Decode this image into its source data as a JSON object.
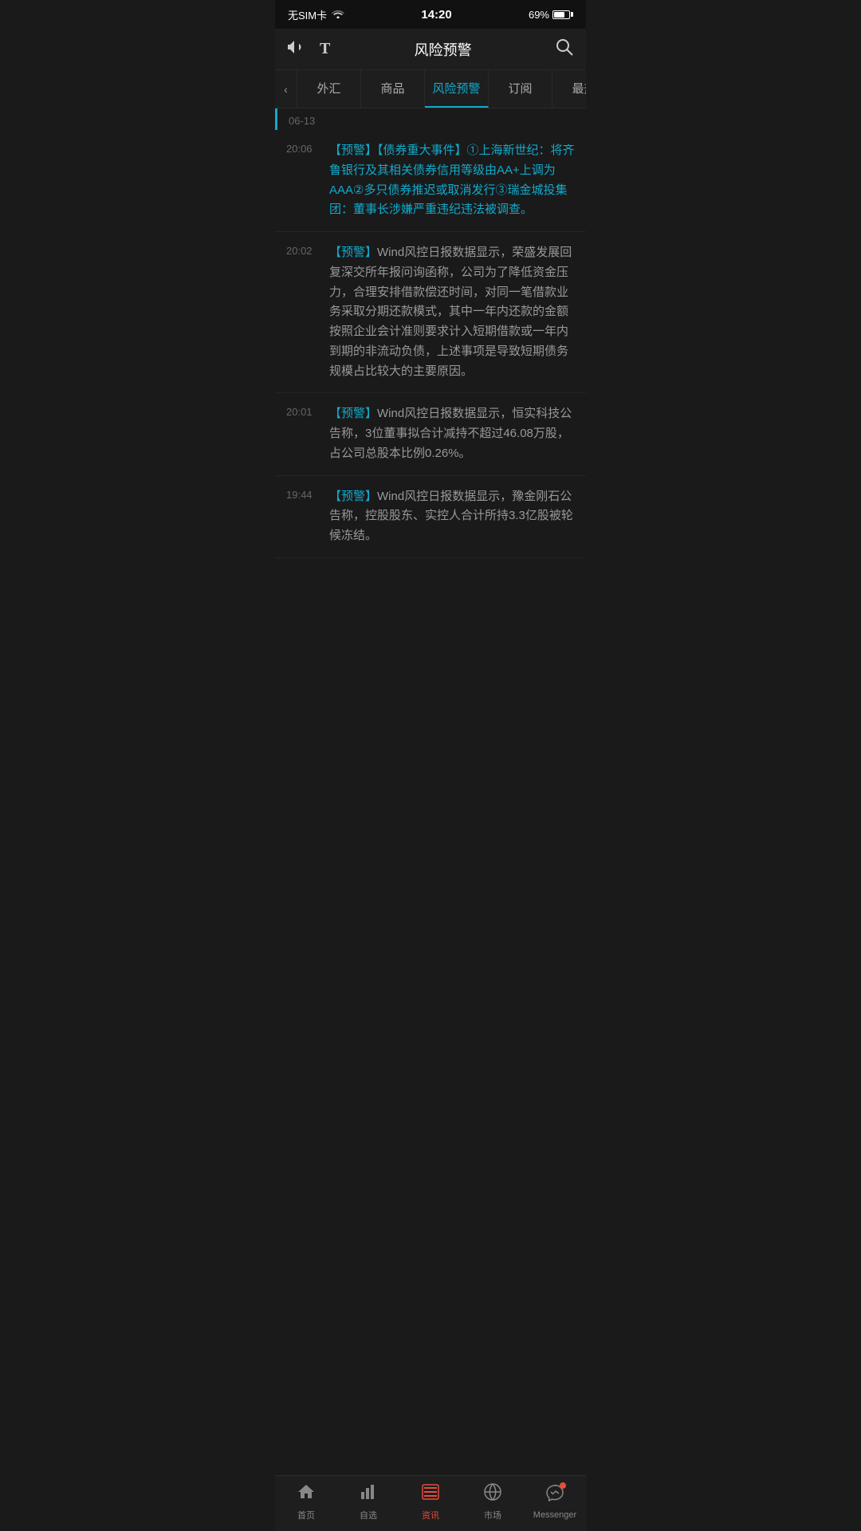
{
  "statusBar": {
    "carrier": "无SIM卡",
    "wifi": "📶",
    "time": "14:20",
    "battery": "69%"
  },
  "header": {
    "title": "风险预警",
    "volumeIcon": "🔈",
    "fontIcon": "T",
    "searchIcon": "🔍"
  },
  "tabs": [
    {
      "id": "forex",
      "label": "外汇",
      "active": false
    },
    {
      "id": "commodity",
      "label": "商品",
      "active": false
    },
    {
      "id": "risk",
      "label": "风险预警",
      "active": true
    },
    {
      "id": "subscribe",
      "label": "订阅",
      "active": false
    },
    {
      "id": "hot",
      "label": "最热",
      "active": false
    }
  ],
  "dateSection": "06-13",
  "newsList": [
    {
      "time": "20:06",
      "content": "【预警】【债券重大事件】①上海新世纪：将齐鲁银行及其相关债券信用等级由AA+上调为AAA②多只债券推迟或取消发行③瑞金城投集团：董事长涉嫌严重违纪违法被调查。",
      "highlight": true
    },
    {
      "time": "20:02",
      "content": "【预警】Wind风控日报数据显示，荣盛发展回复深交所年报问询函称，公司为了降低资金压力，合理安排借款偿还时间，对同一笔借款业务采取分期还款模式，其中一年内还款的金额按照企业会计准则要求计入短期借款或一年内到期的非流动负债，上述事项是导致短期债务规模占比较大的主要原因。",
      "highlight": false
    },
    {
      "time": "20:01",
      "content": "【预警】Wind风控日报数据显示，恒实科技公告称，3位董事拟合计减持不超过46.08万股，占公司总股本比例0.26%。",
      "highlight": false
    },
    {
      "time": "19:44",
      "content": "【预警】Wind风控日报数据显示，豫金刚石公告称，控股股东、实控人合计所持3.3亿股被轮候冻结。",
      "highlight": false
    }
  ],
  "bottomNav": [
    {
      "id": "home",
      "label": "首页",
      "icon": "home",
      "active": false
    },
    {
      "id": "watchlist",
      "label": "自选",
      "icon": "chart",
      "active": false
    },
    {
      "id": "news",
      "label": "资讯",
      "icon": "news",
      "active": true
    },
    {
      "id": "market",
      "label": "市场",
      "icon": "globe",
      "active": false
    },
    {
      "id": "messenger",
      "label": "Messenger",
      "icon": "star",
      "active": false,
      "badge": true
    }
  ]
}
